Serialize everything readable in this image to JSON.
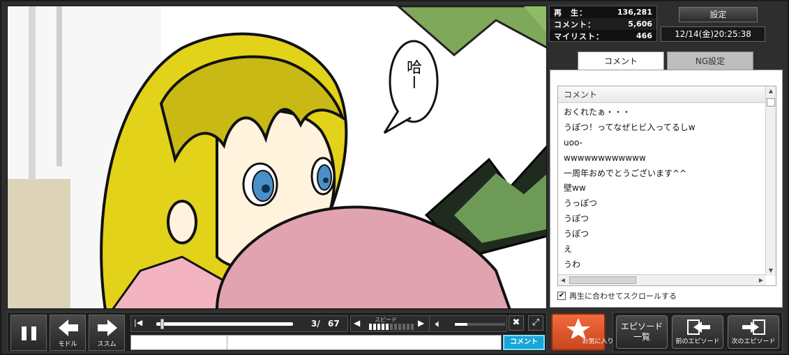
{
  "stats": {
    "play_label": "再　生：",
    "play_count": "136,281",
    "comment_label": "コメント：",
    "comment_count": "5,606",
    "mylist_label": "マイリスト：",
    "mylist_count": "466"
  },
  "header": {
    "settings_label": "設定",
    "datetime": "12/14(金)20:25:38"
  },
  "manga": {
    "speech_bubble": "哈ー"
  },
  "comment_panel": {
    "tabs": [
      {
        "label": "コメント"
      },
      {
        "label": "NG設定"
      }
    ],
    "column_header": "コメント",
    "comments": [
      "おくれたぁ・・・",
      "うぽつ！ってなぜヒビ入ってるしw",
      "uoo-",
      "wwwwwwwwwwww",
      "一周年おめでとうございます^^",
      "壁ww",
      "うっぽつ",
      "うぽつ",
      "うぽつ",
      "え",
      "うわ"
    ],
    "autoscroll_label": "再生に合わせてスクロールする",
    "autoscroll_checked": true
  },
  "controls": {
    "pause_icon": "pause-icon",
    "back_label": "モドル",
    "forward_label": "ススム",
    "page_current": "3/",
    "page_total": "67",
    "speed_label": "スピード",
    "speed_level": 0.45,
    "volume_level": 0.25,
    "seek_position": 0.03,
    "comment_button_label": "コメント"
  },
  "actions": {
    "favorite_label": "お気に入り登録",
    "episode_list_label": "エピソード\n一覧",
    "prev_episode_label": "前のエピソード",
    "next_episode_label": "次のエピソード"
  },
  "colors": {
    "favorite": "#e85a2a",
    "comment_button": "#1aa6d8",
    "hair": "#e3d21a",
    "pillow": "#e2a3b0",
    "eyes": "#4a90c8"
  }
}
